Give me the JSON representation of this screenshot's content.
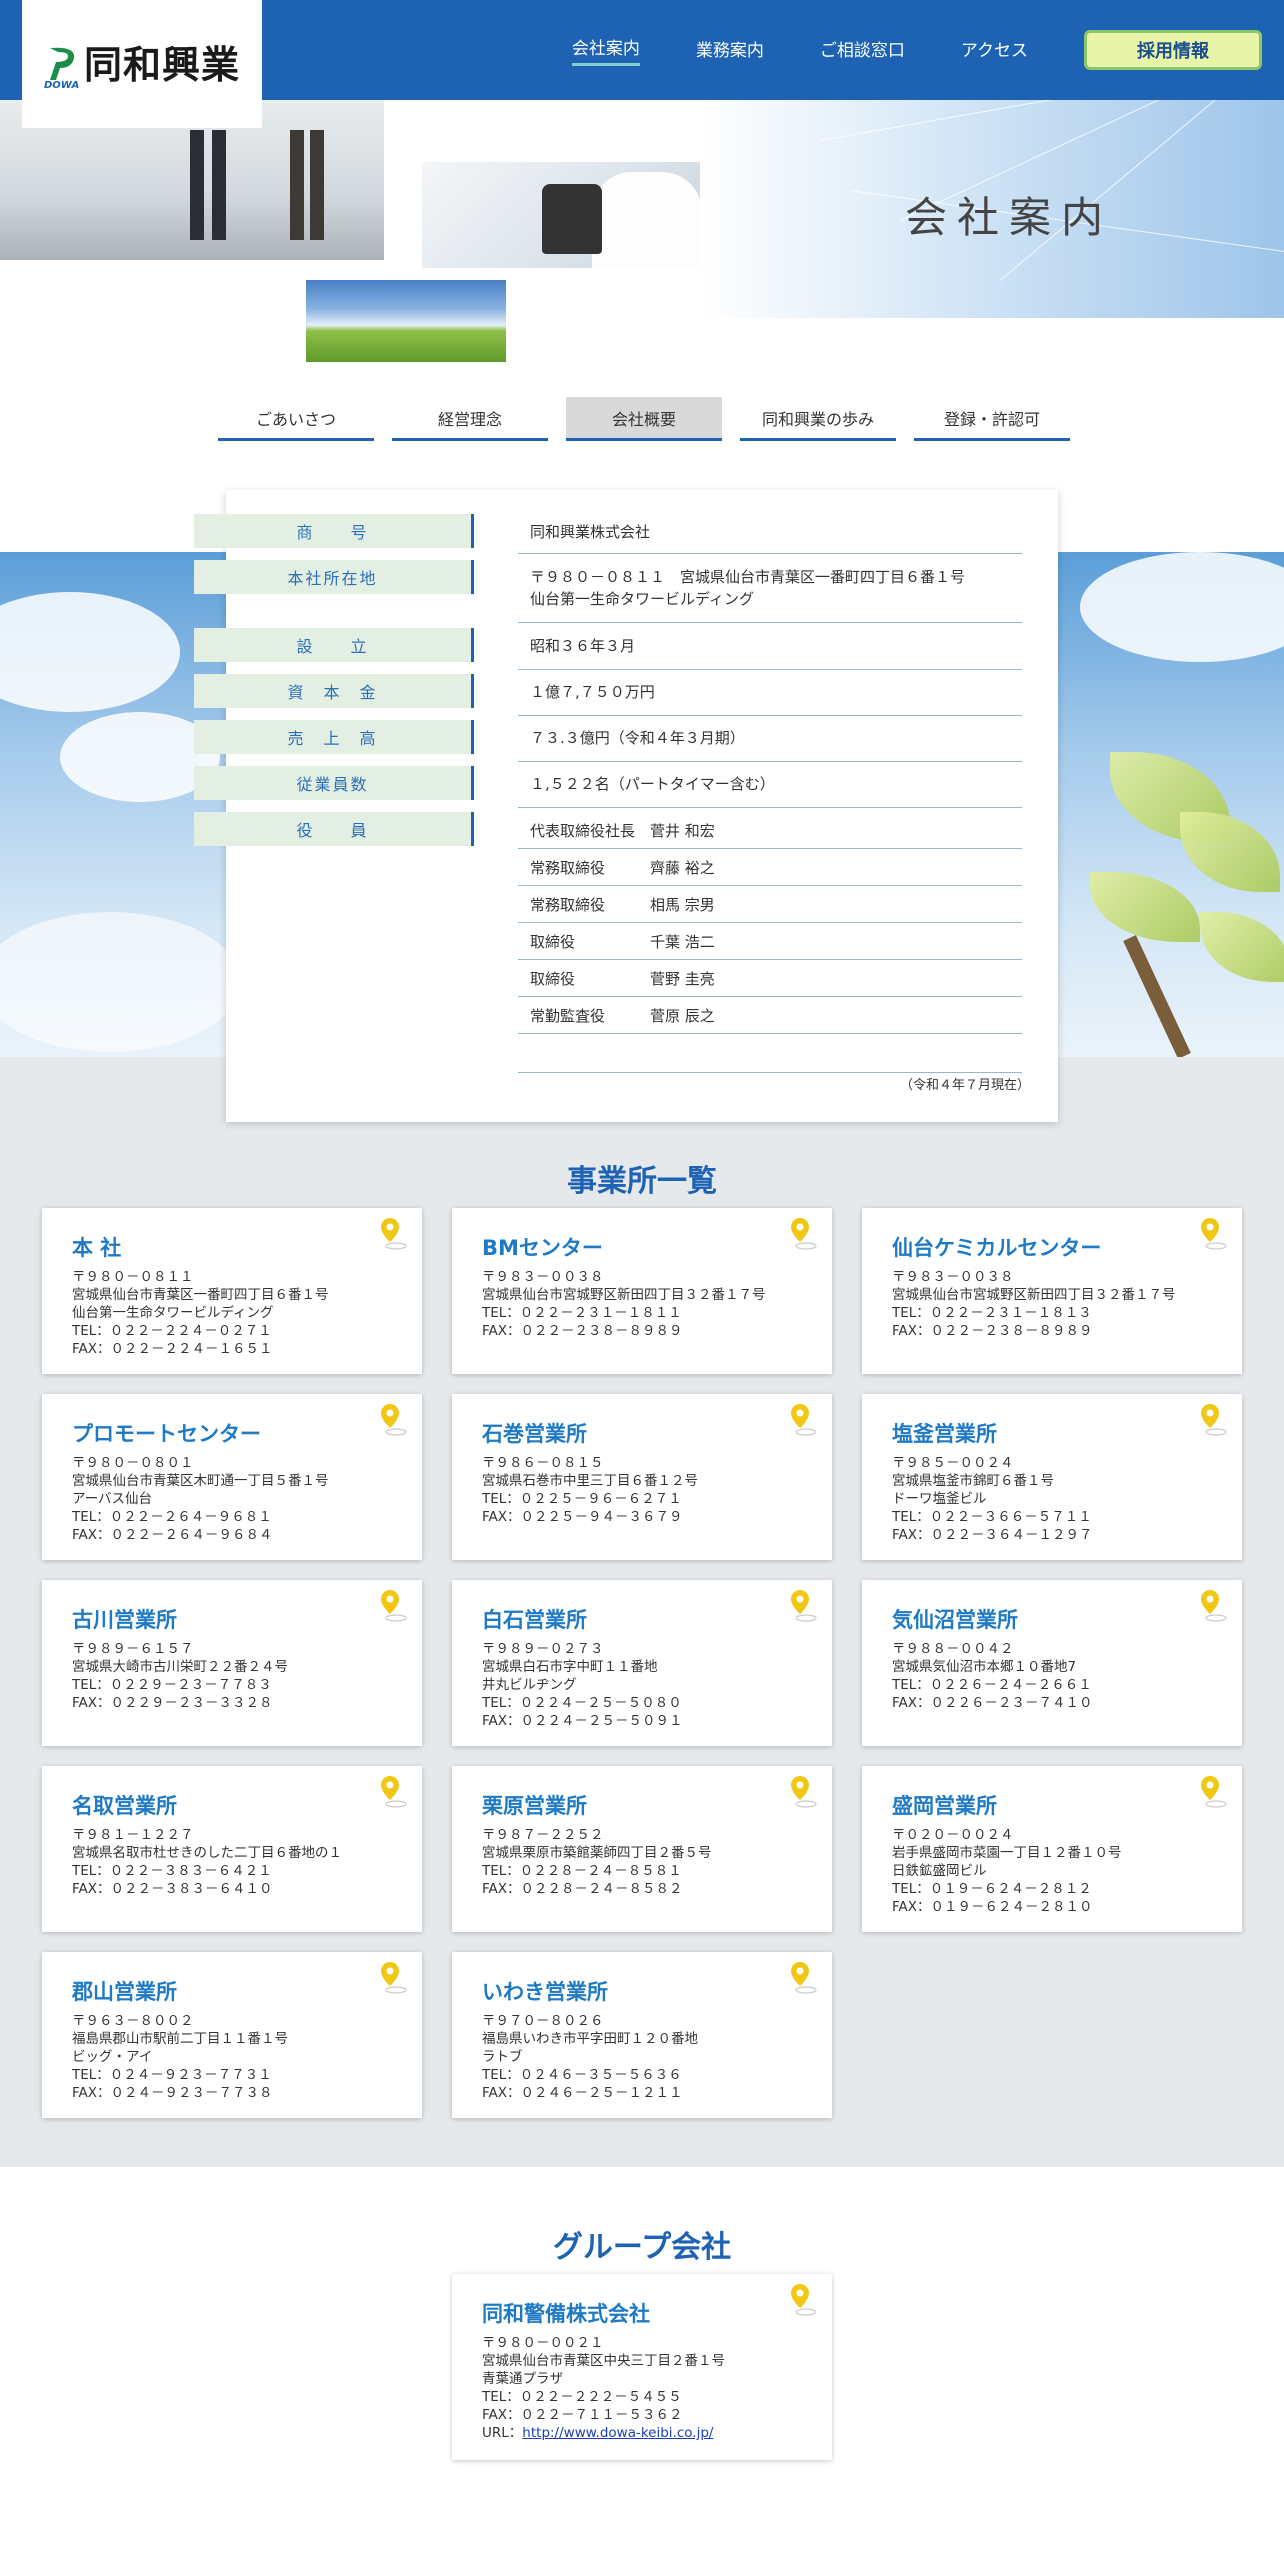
{
  "header": {
    "logo_text": "同和興業",
    "logo_sub": "DOWA",
    "nav": [
      "会社案内",
      "業務案内",
      "ご相談窓口",
      "アクセス"
    ],
    "recruit": "採用情報"
  },
  "hero": {
    "title": "会社案内"
  },
  "tabs": [
    "ごあいさつ",
    "経営理念",
    "会社概要",
    "同和興業の歩み",
    "登録・許認可"
  ],
  "overview": {
    "labels": [
      "商　　号",
      "本社所在地",
      "設　　立",
      "資　本　金",
      "売　上　高",
      "従業員数",
      "役　　員"
    ],
    "trade_name": "同和興業株式会社",
    "address_line1": "〒９８０－０８１１　宮城県仙台市青葉区一番町四丁目６番１号",
    "address_line2": "仙台第一生命タワービルディング",
    "founded": "昭和３６年３月",
    "capital": "１億７,７５０万円",
    "sales": "７３.３億円（令和４年３月期）",
    "employees": "１,５２２名（パートタイマー含む）",
    "officers": [
      {
        "role": "代表取締役社長",
        "name": "菅井 和宏"
      },
      {
        "role": "常務取締役",
        "name": "齊藤 裕之"
      },
      {
        "role": "常務取締役",
        "name": "相馬 宗男"
      },
      {
        "role": "取締役",
        "name": "千葉 浩二"
      },
      {
        "role": "取締役",
        "name": "菅野 圭亮"
      },
      {
        "role": "常勤監査役",
        "name": "菅原 辰之"
      }
    ],
    "note": "（令和４年７月現在）"
  },
  "offices_title": "事業所一覧",
  "offices": [
    {
      "name": "本 社",
      "lines": [
        "〒９８０－０８１１",
        "宮城県仙台市青葉区一番町四丁目６番１号",
        "仙台第一生命タワービルディング",
        "TEL：０２２－２２４－０２７１",
        "FAX：０２２－２２４－１６５１"
      ]
    },
    {
      "name": "BMセンター",
      "lines": [
        "〒９８３－００３８",
        "宮城県仙台市宮城野区新田四丁目３２番１７号",
        "TEL：０２２－２３１－１８１１",
        "FAX：０２２－２３８－８９８９"
      ]
    },
    {
      "name": "仙台ケミカルセンター",
      "lines": [
        "〒９８３－００３８",
        "宮城県仙台市宮城野区新田四丁目３２番１７号",
        "TEL：０２２－２３１－１８１３",
        "FAX：０２２－２３８－８９８９"
      ]
    },
    {
      "name": "プロモートセンター",
      "lines": [
        "〒９８０－０８０１",
        "宮城県仙台市青葉区木町通一丁目５番１号",
        "アーバス仙台",
        "TEL：０２２－２６４－９６８１",
        "FAX：０２２－２６４－９６８４"
      ]
    },
    {
      "name": "石巻営業所",
      "lines": [
        "〒９８６－０８１５",
        "宮城県石巻市中里三丁目６番１２号",
        "TEL：０２２５－９６－６２７１",
        "FAX：０２２５－９４－３６７９"
      ]
    },
    {
      "name": "塩釜営業所",
      "lines": [
        "〒９８５－００２４",
        "宮城県塩釜市錦町６番１号",
        "ドーワ塩釜ビル",
        "TEL：０２２－３６６－５７１１",
        "FAX：０２２－３６４－１２９７"
      ]
    },
    {
      "name": "古川営業所",
      "lines": [
        "〒９８９－６１５７",
        "宮城県大崎市古川栄町２２番２４号",
        "TEL：０２２９－２３－７７８３",
        "FAX：０２２９－２３－３３２８"
      ]
    },
    {
      "name": "白石営業所",
      "lines": [
        "〒９８９－０２７３",
        "宮城県白石市字中町１１番地",
        "井丸ビルヂング",
        "TEL：０２２４－２５－５０８０",
        "FAX：０２２４－２５－５０９１"
      ]
    },
    {
      "name": "気仙沼営業所",
      "lines": [
        "〒９８８－００４２",
        "宮城県気仙沼市本郷１０番地7",
        "TEL：０２２６－２４－２６６１",
        "FAX：０２２６－２３－７４１０"
      ]
    },
    {
      "name": "名取営業所",
      "lines": [
        "〒９８１－１２２７",
        "宮城県名取市杜せきのした二丁目６番地の１",
        "TEL：０２２－３８３－６４２１",
        "FAX：０２２－３８３－６４１０"
      ]
    },
    {
      "name": "栗原営業所",
      "lines": [
        "〒９８７－２２５２",
        "宮城県栗原市築館薬師四丁目２番５号",
        "TEL：０２２８－２４－８５８１",
        "FAX：０２２８－２４－８５８２"
      ]
    },
    {
      "name": "盛岡営業所",
      "lines": [
        "〒０２０－００２４",
        "岩手県盛岡市菜園一丁目１２番１０号",
        "日鉄鉱盛岡ビル",
        "TEL：０１９－６２４－２８１２",
        "FAX：０１９－６２４－２８１０"
      ]
    },
    {
      "name": "郡山営業所",
      "lines": [
        "〒９６３－８００２",
        "福島県郡山市駅前二丁目１１番１号",
        "ビッグ・アイ",
        "TEL：０２４－９２３－７７３１",
        "FAX：０２４－９２３－７７３８"
      ]
    },
    {
      "name": "いわき営業所",
      "lines": [
        "〒９７０－８０２６",
        "福島県いわき市平字田町１２０番地",
        "ラトブ",
        "TEL：０２４６－３５－５６３６",
        "FAX：０２４６－２５－１２１１"
      ]
    }
  ],
  "group_title": "グループ会社",
  "group": {
    "name": "同和警備株式会社",
    "lines": [
      "〒９８０－００２１",
      "宮城県仙台市青葉区中央三丁目２番１号",
      "青葉通プラザ",
      "TEL：０２２－２２２－５４５５",
      "FAX：０２２－７１１－５３６２"
    ],
    "url_label": "URL：",
    "url": "http://www.dowa-keibi.co.jp/"
  },
  "colors": {
    "brand_blue": "#1d62b3",
    "office_name": "#1f7ac4",
    "recruit_bg": "#e8f5a8",
    "pin": "#f0c814"
  }
}
